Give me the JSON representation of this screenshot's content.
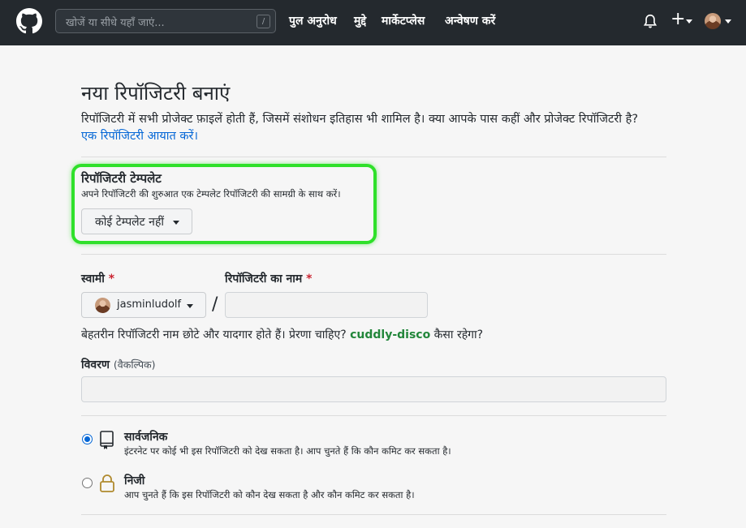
{
  "header": {
    "search_placeholder": "खोजें या सीधे यहाँ जाएं...",
    "search_shortcut": "/",
    "nav": [
      {
        "label": "पुल अनुरोध"
      },
      {
        "label": "मुद्दे"
      },
      {
        "label": "मार्केटप्लेस"
      },
      {
        "label": "अन्वेषण करें"
      }
    ],
    "plus_label": "+"
  },
  "page": {
    "title": "नया रिपॉजिटरी बनाएं",
    "subtitle": "रिपॉजिटरी में सभी प्रोजेक्ट फ़ाइलें होती हैं, जिसमें संशोधन इतिहास भी शामिल है। क्या आपके पास कहीं और प्रोजेक्ट रिपॉजिटरी है?",
    "import_link": "एक रिपॉजिटरी आयात करें।"
  },
  "template": {
    "title": "रिपॉजिटरी टेम्पलेट",
    "description": "अपने रिपॉजिटरी की शुरुआत एक टेम्पलेट रिपॉजिटरी की सामग्री के साथ करें।",
    "selected": "कोई टेम्पलेट नहीं"
  },
  "owner": {
    "label": "स्वामी",
    "required_mark": "*",
    "selected": "jasminludolf"
  },
  "repo_name": {
    "label": "रिपॉजिटरी का नाम",
    "required_mark": "*",
    "value": "",
    "separator": "/"
  },
  "name_hint": {
    "before": "बेहतरीन रिपॉजिटरी नाम छोटे और यादगार होते हैं। प्रेरणा चाहिए?",
    "suggestion": "cuddly-disco",
    "after": "कैसा रहेगा?"
  },
  "description_field": {
    "label": "विवरण",
    "optional": "(वैकल्पिक)",
    "value": ""
  },
  "visibility": {
    "selected": "public",
    "public": {
      "title": "सार्वजनिक",
      "description": "इंटरनेट पर कोई भी इस रिपॉजिटरी को देख सकता है। आप चुनते हैं कि कौन कमिट कर सकता है।"
    },
    "private": {
      "title": "निजी",
      "description": "आप चुनते हैं कि इस रिपॉजिटरी को कौन देख सकता है और कौन कमिट कर सकता है।"
    }
  },
  "colors": {
    "header_bg": "#24292e",
    "link": "#0366d6",
    "suggestion": "#22863a",
    "highlight": "#2fe02a",
    "required": "#cb2431"
  }
}
